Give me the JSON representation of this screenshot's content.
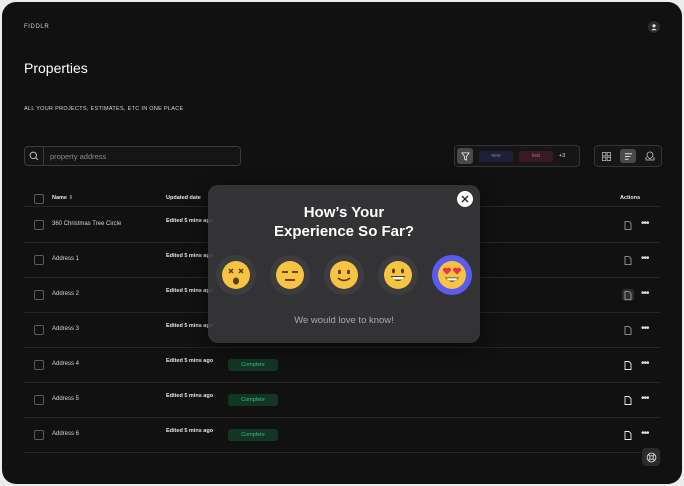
{
  "brand": "FIDDLR",
  "page": {
    "title": "Properties",
    "subtitle": "ALL YOUR PROJECTS, ESTIMATES, ETC IN ONE PLACE"
  },
  "search": {
    "placeholder": "property address",
    "icon": "search-icon"
  },
  "filters": {
    "chips": [
      "new",
      "lost"
    ],
    "more": "+3"
  },
  "table": {
    "headers": {
      "name": "Name",
      "updated": "Updated date",
      "actions": "Actions"
    },
    "rows": [
      {
        "name": "360 Christmas Tree Circle",
        "updated": "Edited 5 mins ago",
        "status": ""
      },
      {
        "name": "Address 1",
        "updated": "Edited 5 mins ago",
        "status": ""
      },
      {
        "name": "Address 2",
        "updated": "Edited 5 mins ago",
        "status": ""
      },
      {
        "name": "Address 3",
        "updated": "Edited 5 mins ago",
        "status": ""
      },
      {
        "name": "Address 4",
        "updated": "Edited 5 mins ago",
        "status": "Complete"
      },
      {
        "name": "Address 5",
        "updated": "Edited 5 mins ago",
        "status": "Complete"
      },
      {
        "name": "Address 6",
        "updated": "Edited 5 mins ago",
        "status": "Complete"
      }
    ]
  },
  "modal": {
    "title_line1": "How’s Your",
    "title_line2": "Experience So Far?",
    "note": "We would love to know!",
    "options": [
      "dizzy-face-emoji",
      "expressionless-face-emoji",
      "slightly-smiling-face-emoji",
      "grinning-face-emoji",
      "heart-eyes-face-emoji"
    ],
    "selected_index": 4,
    "accent": "#5a5cf0"
  },
  "colors": {
    "background": "#111111",
    "complete": "#34c27a"
  }
}
